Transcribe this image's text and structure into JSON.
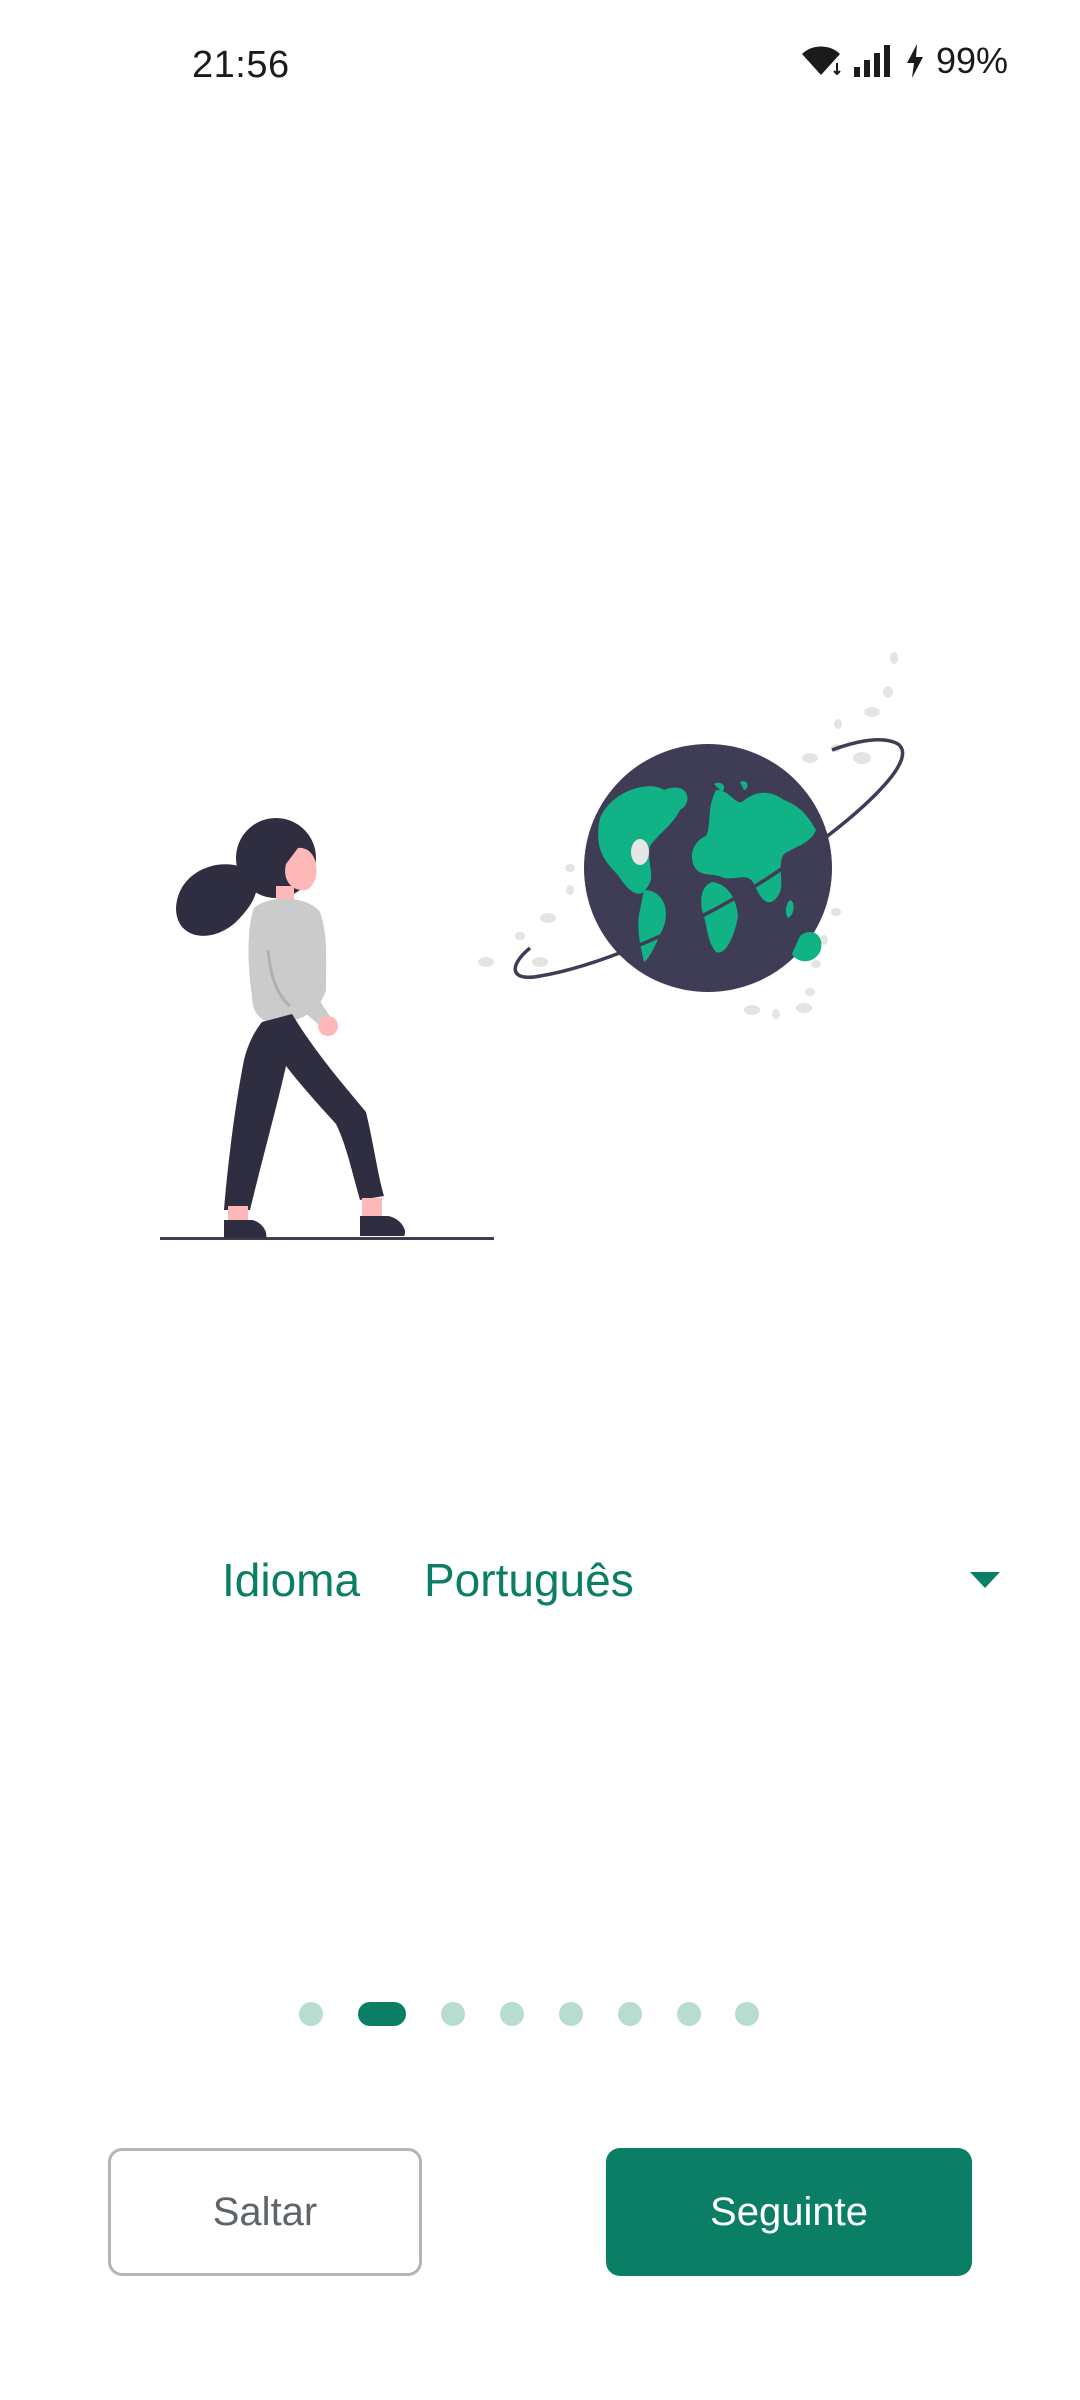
{
  "status_bar": {
    "time": "21:56",
    "battery_percent": "99%",
    "icons": [
      "wifi-icon",
      "signal-icon",
      "charging-icon"
    ]
  },
  "illustration": {
    "icons": [
      "woman-walking-illustration",
      "globe-illustration"
    ]
  },
  "language": {
    "label": "Idioma",
    "selected": "Português",
    "icon": "dropdown-arrow-icon"
  },
  "pager": {
    "total_pages": 8,
    "current_page": 2
  },
  "buttons": {
    "skip_label": "Saltar",
    "next_label": "Seguinte"
  },
  "colors": {
    "accent": "#0b7f65",
    "globe_land": "#11b386",
    "globe_ocean": "#3f3d56",
    "dot_inactive": "#b7dcd0"
  }
}
